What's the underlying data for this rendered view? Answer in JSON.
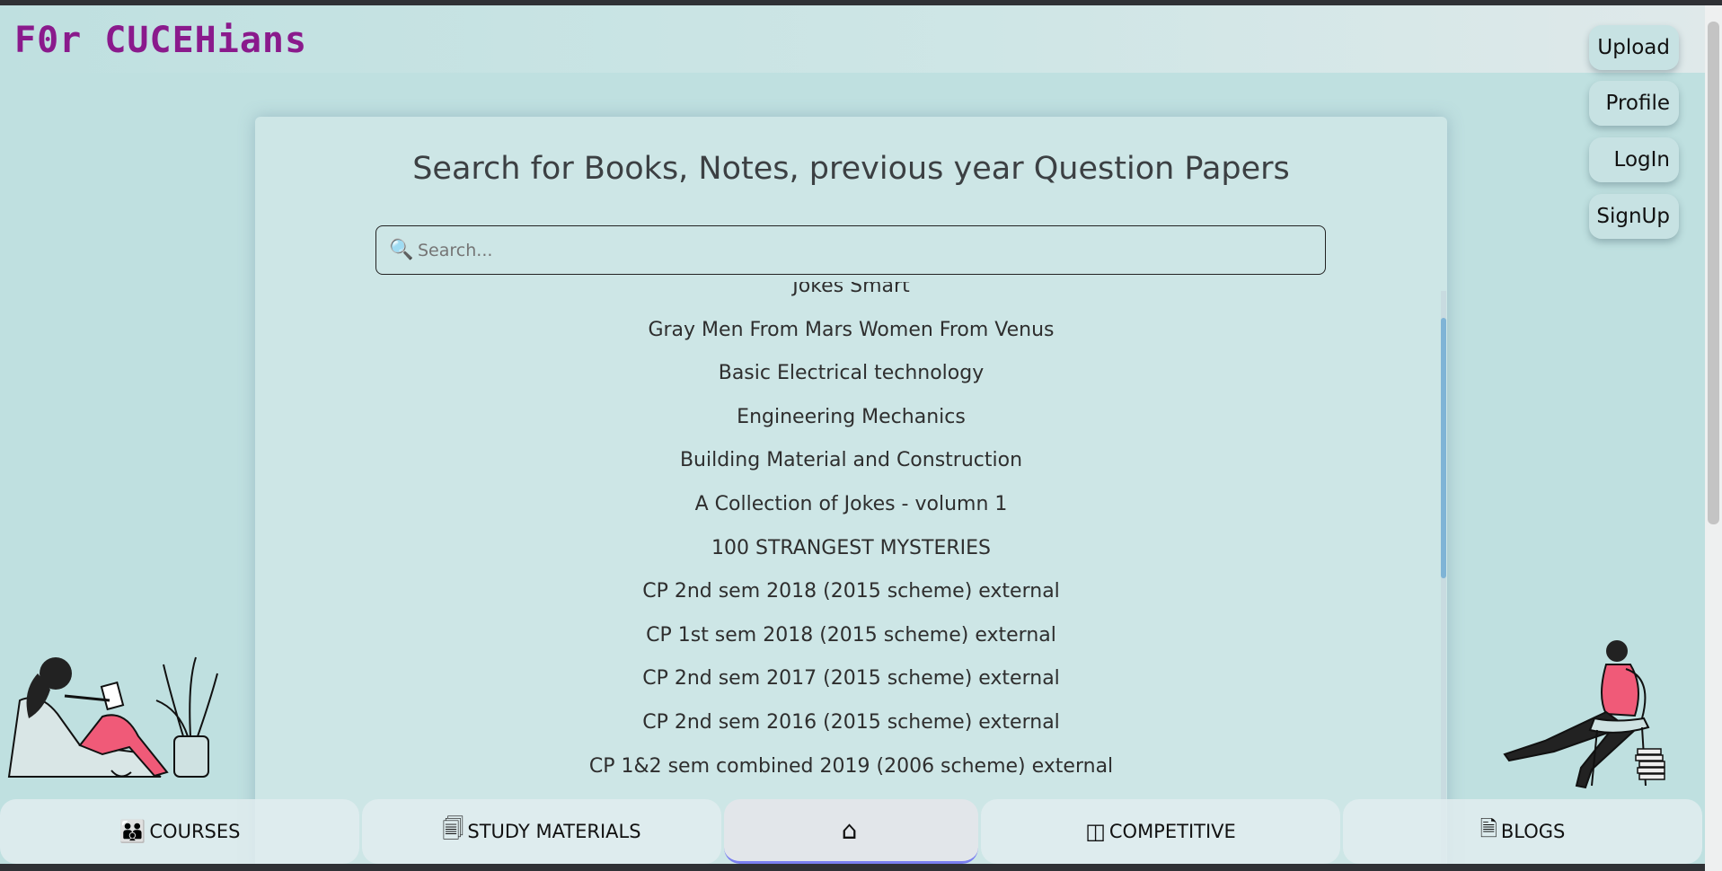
{
  "header": {
    "logo": "F0r CUCEHians"
  },
  "side_buttons": [
    "Upload",
    "Profile",
    "LogIn",
    "SignUp"
  ],
  "main": {
    "title": "Search for Books, Notes, previous year Question Papers",
    "search_placeholder": "Search...",
    "results": [
      "Jokes Smart",
      "Gray Men From Mars Women From Venus",
      "Basic Electrical technology",
      "Engineering Mechanics",
      "Building Material and Construction",
      "A Collection of Jokes - volumn 1",
      "100 STRANGEST MYSTERIES",
      "CP 2nd sem 2018 (2015 scheme) external",
      "CP 1st sem 2018 (2015 scheme) external",
      "CP 2nd sem 2017 (2015 scheme) external",
      "CP 2nd sem 2016 (2015 scheme) external",
      "CP 1&2 sem combined 2019 (2006 scheme) external"
    ]
  },
  "bottom_nav": {
    "courses": "COURSES",
    "study": "STUDY MATERIALS",
    "home_icon": "home-icon",
    "competitive": "COMPETITIVE",
    "blogs": "BLOGS"
  },
  "colors": {
    "logo": "#8a1a8c",
    "background": "#bfe0e0",
    "accent": "#f05a78"
  }
}
